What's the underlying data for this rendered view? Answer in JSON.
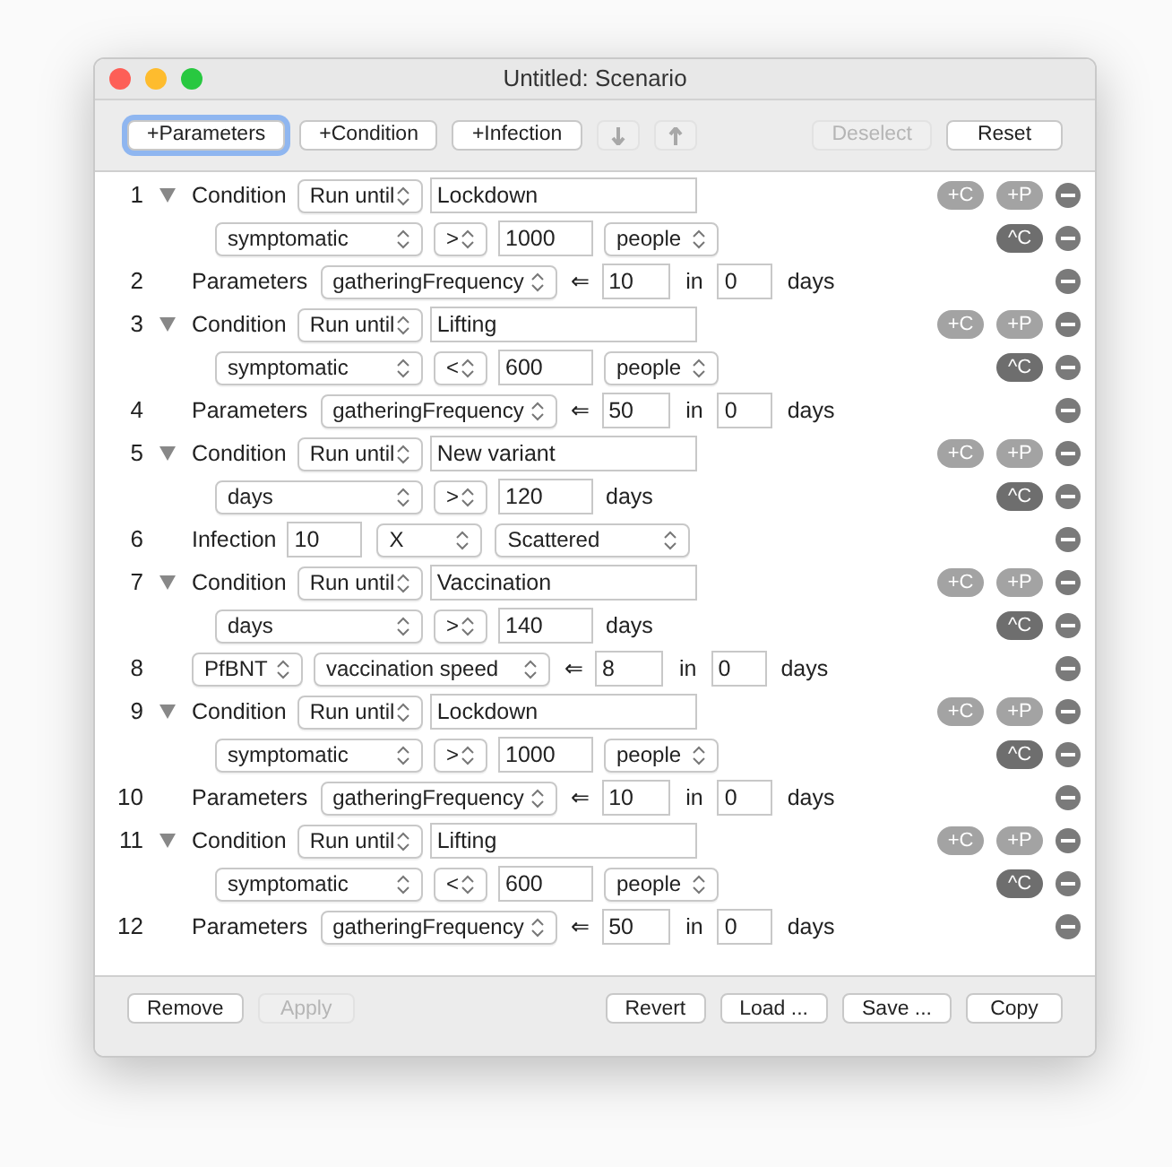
{
  "window": {
    "title": "Untitled: Scenario"
  },
  "toolbar": {
    "left": [
      {
        "kind": "text",
        "label": "+Parameters",
        "focused": true,
        "disabled": false
      },
      {
        "kind": "text",
        "label": "+Condition",
        "focused": false,
        "disabled": false
      },
      {
        "kind": "text",
        "label": "+Infection",
        "focused": false,
        "disabled": false
      },
      {
        "kind": "down",
        "focused": false,
        "disabled": true
      },
      {
        "kind": "up",
        "focused": false,
        "disabled": true
      }
    ],
    "right": [
      {
        "kind": "text",
        "label": "Deselect",
        "focused": false,
        "disabled": true
      },
      {
        "kind": "text",
        "label": "Reset",
        "focused": false,
        "disabled": false
      }
    ]
  },
  "rows": [
    {
      "kind": "condition",
      "number": "1",
      "expanded": true,
      "label": "Condition",
      "mode": "Run until",
      "name": "Lockdown",
      "criterion": {
        "variable": "symptomatic",
        "operator": ">",
        "value": "1000",
        "unit": {
          "kind": "select",
          "text": "people"
        }
      },
      "add_buttons": [
        {
          "label": "+C",
          "disabled": true
        },
        {
          "label": "+P",
          "disabled": true
        }
      ],
      "criterion_button": {
        "label": "^C",
        "disabled": false
      }
    },
    {
      "kind": "parameters",
      "number": "2",
      "label": "Parameters",
      "parameter": "gatheringFrequency",
      "arrow": "⇐",
      "value": "10",
      "in": "in",
      "delay": "0",
      "unit": "days"
    },
    {
      "kind": "condition",
      "number": "3",
      "expanded": true,
      "label": "Condition",
      "mode": "Run until",
      "name": "Lifting",
      "criterion": {
        "variable": "symptomatic",
        "operator": "<",
        "value": "600",
        "unit": {
          "kind": "select",
          "text": "people"
        }
      },
      "add_buttons": [
        {
          "label": "+C",
          "disabled": true
        },
        {
          "label": "+P",
          "disabled": true
        }
      ],
      "criterion_button": {
        "label": "^C",
        "disabled": false
      }
    },
    {
      "kind": "parameters",
      "number": "4",
      "label": "Parameters",
      "parameter": "gatheringFrequency",
      "arrow": "⇐",
      "value": "50",
      "in": "in",
      "delay": "0",
      "unit": "days"
    },
    {
      "kind": "condition",
      "number": "5",
      "expanded": true,
      "label": "Condition",
      "mode": "Run until",
      "name": "New variant",
      "criterion": {
        "variable": "days",
        "operator": ">",
        "value": "120",
        "unit": {
          "kind": "text",
          "text": "days"
        }
      },
      "add_buttons": [
        {
          "label": "+C",
          "disabled": true
        },
        {
          "label": "+P",
          "disabled": true
        }
      ],
      "criterion_button": {
        "label": "^C",
        "disabled": false
      }
    },
    {
      "kind": "infection",
      "number": "6",
      "label": "Infection",
      "count": "10",
      "location": "X",
      "pattern": "Scattered"
    },
    {
      "kind": "condition",
      "number": "7",
      "expanded": true,
      "label": "Condition",
      "mode": "Run until",
      "name": "Vaccination",
      "criterion": {
        "variable": "days",
        "operator": ">",
        "value": "140",
        "unit": {
          "kind": "text",
          "text": "days"
        }
      },
      "add_buttons": [
        {
          "label": "+C",
          "disabled": true
        },
        {
          "label": "+P",
          "disabled": true
        }
      ],
      "criterion_button": {
        "label": "^C",
        "disabled": false
      }
    },
    {
      "kind": "parameters",
      "number": "8",
      "group": "PfBNT",
      "parameter": "vaccination speed",
      "arrow": "⇐",
      "value": "8",
      "in": "in",
      "delay": "0",
      "unit": "days"
    },
    {
      "kind": "condition",
      "number": "9",
      "expanded": true,
      "label": "Condition",
      "mode": "Run until",
      "name": "Lockdown",
      "criterion": {
        "variable": "symptomatic",
        "operator": ">",
        "value": "1000",
        "unit": {
          "kind": "select",
          "text": "people"
        }
      },
      "add_buttons": [
        {
          "label": "+C",
          "disabled": true
        },
        {
          "label": "+P",
          "disabled": true
        }
      ],
      "criterion_button": {
        "label": "^C",
        "disabled": false
      }
    },
    {
      "kind": "parameters",
      "number": "10",
      "label": "Parameters",
      "parameter": "gatheringFrequency",
      "arrow": "⇐",
      "value": "10",
      "in": "in",
      "delay": "0",
      "unit": "days"
    },
    {
      "kind": "condition",
      "number": "11",
      "expanded": true,
      "label": "Condition",
      "mode": "Run until",
      "name": "Lifting",
      "criterion": {
        "variable": "symptomatic",
        "operator": "<",
        "value": "600",
        "unit": {
          "kind": "select",
          "text": "people"
        }
      },
      "add_buttons": [
        {
          "label": "+C",
          "disabled": true
        },
        {
          "label": "+P",
          "disabled": true
        }
      ],
      "criterion_button": {
        "label": "^C",
        "disabled": false
      }
    },
    {
      "kind": "parameters",
      "number": "12",
      "label": "Parameters",
      "parameter": "gatheringFrequency",
      "arrow": "⇐",
      "value": "50",
      "in": "in",
      "delay": "0",
      "unit": "days"
    }
  ],
  "footer": {
    "left": [
      {
        "label": "Remove",
        "disabled": false
      },
      {
        "label": "Apply",
        "disabled": true
      }
    ],
    "right": [
      {
        "label": "Revert",
        "disabled": false
      },
      {
        "label": "Load ...",
        "disabled": false
      },
      {
        "label": "Save ...",
        "disabled": false
      },
      {
        "label": "Copy",
        "disabled": false
      }
    ]
  }
}
